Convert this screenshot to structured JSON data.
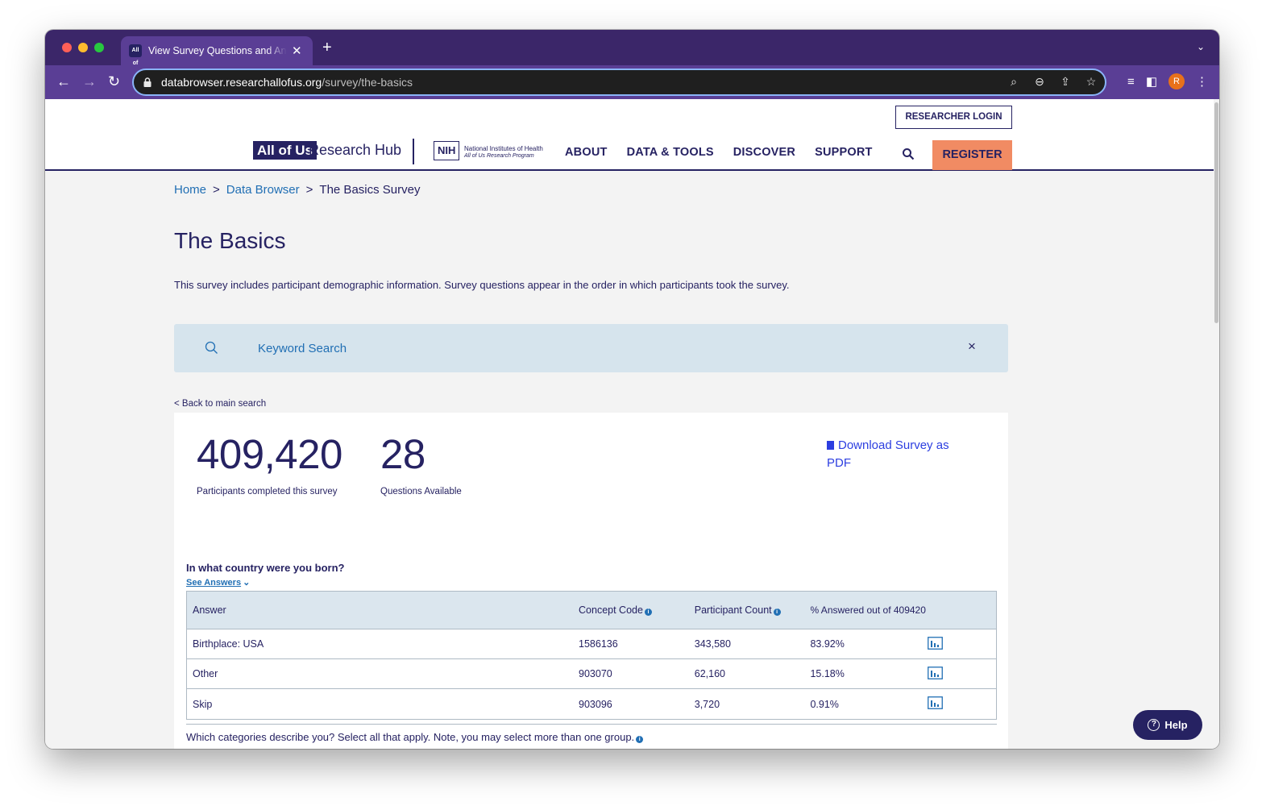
{
  "browser": {
    "tab_title": "View Survey Questions and Answers",
    "tab_favicon": "All of Us",
    "new_tab": "+",
    "url_host": "databrowser.researchallofus.org",
    "url_path": "/survey/the-basics",
    "avatar_letter": "R"
  },
  "header": {
    "researcher_login": "RESEARCHER LOGIN",
    "logo_brand": "All of Us",
    "logo_hub": "Research Hub",
    "nih_logo": "NIH",
    "nih_name": "National Institutes of Health",
    "nih_program": "All of Us Research Program",
    "nav": [
      "ABOUT",
      "DATA & TOOLS",
      "DISCOVER",
      "SUPPORT"
    ],
    "register": "REGISTER"
  },
  "breadcrumb": {
    "home": "Home",
    "separator": ">",
    "data_browser": "Data Browser",
    "current": "The Basics Survey"
  },
  "page": {
    "title": "The Basics",
    "description": "This survey includes participant demographic information. Survey questions appear in the order in which participants took the survey."
  },
  "search": {
    "placeholder": "Keyword Search",
    "clear": "×"
  },
  "back_link": "< Back to main search",
  "stats": {
    "participants_value": "409,420",
    "participants_label": "Participants completed this survey",
    "questions_value": "28",
    "questions_label": "Questions Available",
    "download": "Download Survey as PDF"
  },
  "question": {
    "text": "In what country were you born?",
    "see_answers": "See Answers",
    "columns": {
      "answer": "Answer",
      "concept_code": "Concept Code",
      "participant_count": "Participant Count",
      "percent": "% Answered out of 409420"
    },
    "rows": [
      {
        "answer": "Birthplace: USA",
        "code": "1586136",
        "count": "343,580",
        "percent": "83.92%"
      },
      {
        "answer": "Other",
        "code": "903070",
        "count": "62,160",
        "percent": "15.18%"
      },
      {
        "answer": "Skip",
        "code": "903096",
        "count": "3,720",
        "percent": "0.91%"
      }
    ]
  },
  "next_question": "Which categories describe you? Select all that apply. Note, you may select more than one group.",
  "help": "Help",
  "colors": {
    "brand_navy": "#262262",
    "register_orange": "#f18b63",
    "link_blue": "#216fb4",
    "browser_purple": "#5a3e95"
  }
}
